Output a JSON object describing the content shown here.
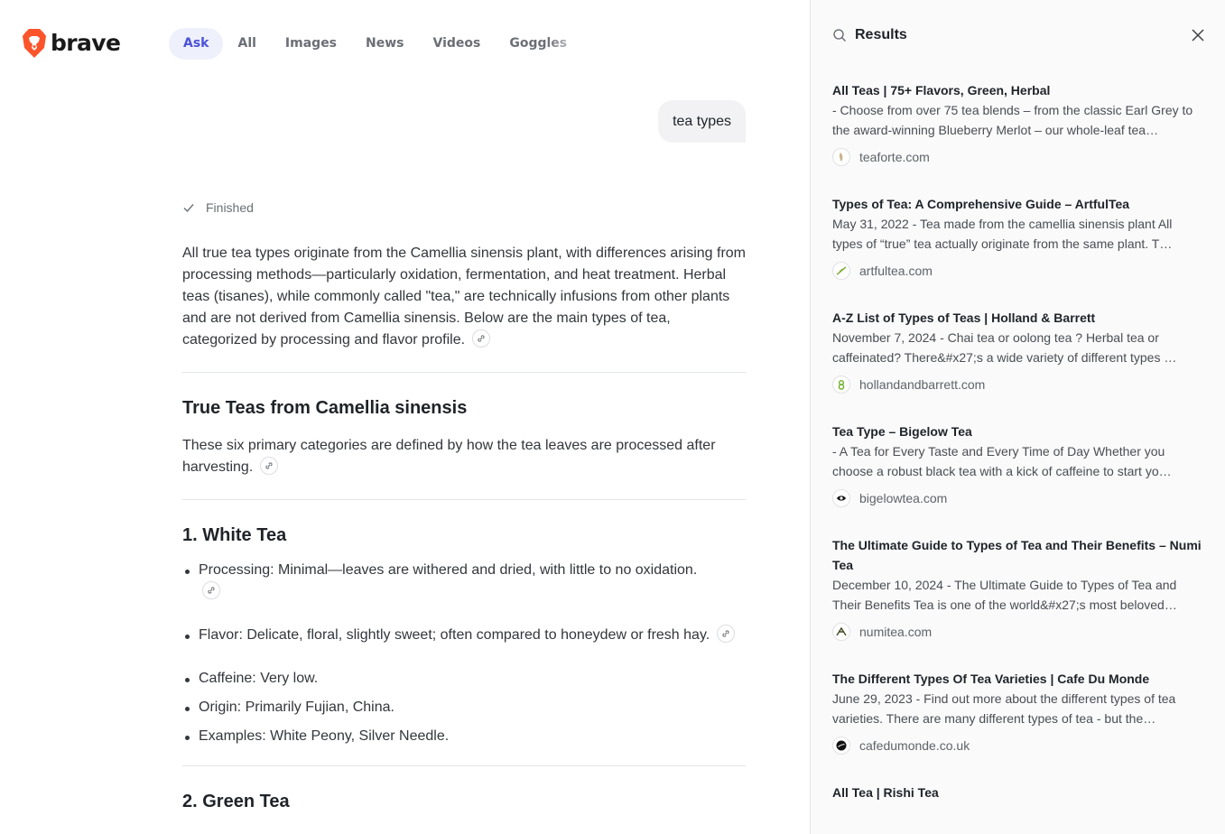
{
  "brand": {
    "name": "brave",
    "color": "#fb542b"
  },
  "tabs": [
    {
      "label": "Ask",
      "active": true
    },
    {
      "label": "All"
    },
    {
      "label": "Images"
    },
    {
      "label": "News"
    },
    {
      "label": "Videos"
    },
    {
      "label": "Goggles"
    }
  ],
  "query": "tea types",
  "status": "Finished",
  "answer": {
    "intro": "All true tea types originate from the Camellia sinensis plant, with differences arising from processing methods—particularly oxidation, fermentation, and heat treatment. Herbal teas (tisanes), while commonly called \"tea,\" are technically infusions from other plants and are not derived from Camellia sinensis. Below are the main types of tea, categorized by processing and flavor profile.",
    "section_title": "True Teas from Camellia sinensis",
    "section_text": "These six primary categories are defined by how the tea leaves are processed after harvesting.",
    "white_tea": {
      "title": "1. White Tea",
      "points": [
        "Processing: Minimal—leaves are withered and dried, with little to no oxidation.",
        "Flavor: Delicate, floral, slightly sweet; often compared to honeydew or fresh hay.",
        "Caffeine: Very low.",
        "Origin: Primarily Fujian, China.",
        "Examples: White Peony, Silver Needle."
      ]
    },
    "next_title": "2. Green Tea"
  },
  "panel": {
    "title": "Results",
    "results": [
      {
        "title": "All Teas | 75+ Flavors, Green, Herbal",
        "snippet": "- Choose from over 75 tea blends – from the classic Earl Grey to the award-winning Blueberry Merlot – our whole-leaf tea…",
        "domain": "teaforte.com",
        "icon": "leaf-icon"
      },
      {
        "title": "Types of Tea: A Comprehensive Guide – ArtfulTea",
        "snippet": "May 31, 2022 - Tea made from the camellia sinensis plant All types of “true” tea actually originate from the same plant. T…",
        "domain": "artfultea.com",
        "icon": "sprig-icon"
      },
      {
        "title": "A-Z List of Types of Teas | Holland & Barrett",
        "snippet": "November 7, 2024 - Chai tea or oolong tea ? Herbal tea or caffeinated? There&#x27;s a wide variety of different types …",
        "domain": "hollandandbarrett.com",
        "icon": "hb-icon"
      },
      {
        "title": "Tea Type – Bigelow Tea",
        "snippet": "- A Tea for Every Taste and Every Time of Day Whether you choose a robust black tea with a kick of caffeine to start yo…",
        "domain": "bigelowtea.com",
        "icon": "eye-icon"
      },
      {
        "title": "The Ultimate Guide to Types of Tea and Their Benefits – Numi Tea",
        "snippet": "December 10, 2024 - The Ultimate Guide to Types of Tea and Their Benefits Tea is one of the world&#x27;s most beloved…",
        "domain": "numitea.com",
        "icon": "numi-icon"
      },
      {
        "title": "The Different Types Of Tea Varieties | Cafe Du Monde",
        "snippet": "June 29, 2023 - Find out more about the different types of tea varieties. There are many different types of tea - but the…",
        "domain": "cafedumonde.co.uk",
        "icon": "dark-circle-icon"
      },
      {
        "title": "All Tea | Rishi Tea",
        "snippet": "",
        "domain": "",
        "icon": ""
      }
    ]
  }
}
